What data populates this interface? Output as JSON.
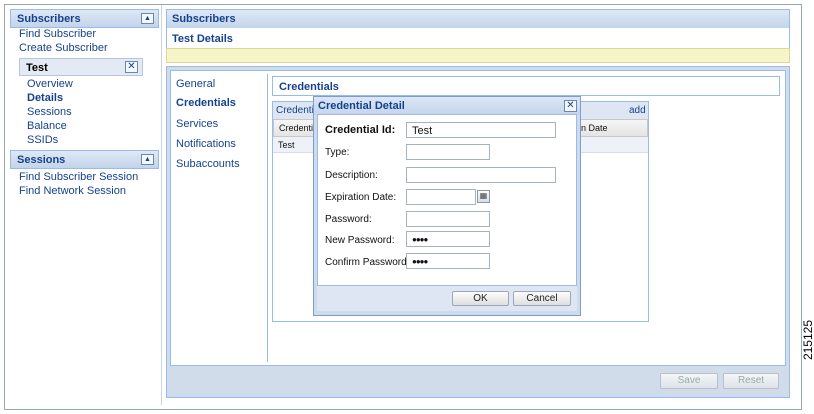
{
  "sidebar": {
    "subscribers_header": "Subscribers",
    "subscribers_collapse": "▲",
    "links": [
      "Find Subscriber",
      "Create Subscriber"
    ],
    "entity": {
      "name": "Test",
      "close": "✕"
    },
    "entity_links": [
      "Overview",
      "Details",
      "Sessions",
      "Balance",
      "SSIDs"
    ],
    "active_entity_link": "Details",
    "sessions_header": "Sessions",
    "sessions_collapse": "▲",
    "session_links": [
      "Find Subscriber Session",
      "Find Network Session"
    ]
  },
  "main": {
    "header": "Subscribers",
    "subheader": "Test Details",
    "tabs": [
      "General",
      "Credentials",
      "Services",
      "Notifications",
      "Subaccounts"
    ],
    "active_tab": "Credentials",
    "credentials_title": "Credentials",
    "grid": {
      "title": "Credenti",
      "add_link": "add",
      "columns": [
        "Credentia",
        "on Date"
      ],
      "rows": [
        [
          "Test",
          ""
        ]
      ]
    },
    "buttons": {
      "save": "Save",
      "reset": "Reset"
    }
  },
  "dialog": {
    "title": "Credential Detail",
    "close": "✕",
    "fields": {
      "credential_id": {
        "label": "Credential Id:",
        "value": "Test"
      },
      "type": {
        "label": "Type:",
        "value": ""
      },
      "description": {
        "label": "Description:",
        "value": ""
      },
      "expiration_date": {
        "label": "Expiration Date:",
        "value": ""
      },
      "password": {
        "label": "Password:",
        "value": ""
      },
      "new_password": {
        "label": "New Password:",
        "value": "●●●●"
      },
      "confirm_password": {
        "label": "Confirm Password:",
        "value": "●●●●"
      }
    },
    "ok": "OK",
    "cancel": "Cancel"
  },
  "figure_number": "215125",
  "colors": {
    "accent": "#15428b",
    "panel_border": "#99bbe8",
    "header_bg": "#c3d4ea"
  }
}
